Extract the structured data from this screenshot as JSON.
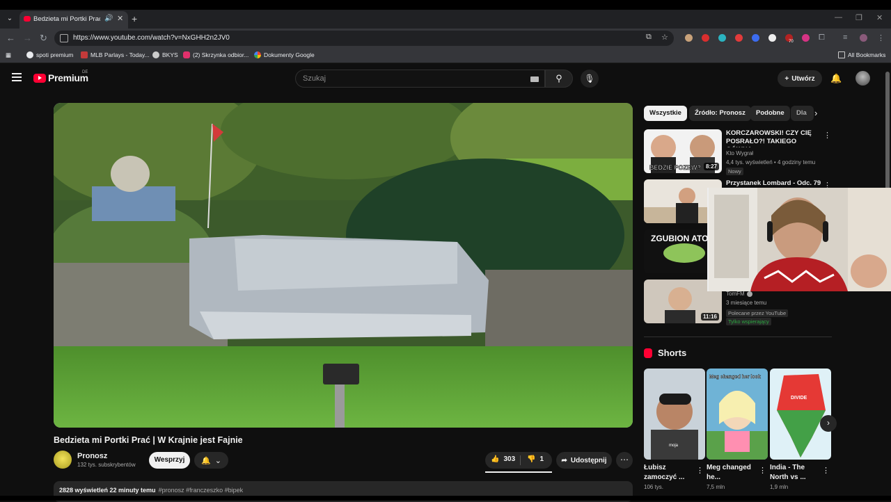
{
  "browser": {
    "tab_title": "Bedzieta mi Portki Prać | W",
    "url": "https://www.youtube.com/watch?v=NxGHH2n2JV0",
    "bookmarks": [
      {
        "label": "spoti premium",
        "color": "#e8eaed"
      },
      {
        "label": "MLB Parlays - Today...",
        "color": "#c23a3a"
      },
      {
        "label": "BKYS",
        "color": "#cccccc"
      },
      {
        "label": "(2) Skrzynka odbior...",
        "color": "#e1306c"
      },
      {
        "label": "Dokumenty Google",
        "color": "#4285f4"
      }
    ],
    "all_bookmarks": "All Bookmarks",
    "extension_badge": "70"
  },
  "header": {
    "logo_text": "Premium",
    "country_code": "DE",
    "search_placeholder": "Szukaj",
    "create_label": "Utwórz"
  },
  "video": {
    "title": "Bedzieta mi Portki Prać | W Krajnie jest Fajnie",
    "channel": "Pronosz",
    "subscribers": "132 tys. subskrybentów",
    "support_label": "Wesprzyj",
    "likes": "303",
    "dislikes": "1",
    "share_label": "Udostępnij",
    "description_meta": "2828 wyświetleń  22 minuty temu",
    "description_tags": "#pronosz #franczeszko #bipek"
  },
  "chips": [
    "Wszystkie",
    "Źródło: Pronosz",
    "Podobne",
    "Dla"
  ],
  "recommendations": [
    {
      "title": "KORCZAROWSKI! CZY CIĘ POSRAŁO?! TAKIEGO GÓWNA ...",
      "channel": "Kto Wygrał",
      "meta": "4,4 tys. wyświetleń • 4 godziny temu",
      "badge": "Nowy",
      "duration": "8:27",
      "thumb_text": "BĘDZIE POZEW?"
    },
    {
      "title": "Przystanek Lombard - Odc. 79",
      "channel": "",
      "meta": "",
      "badge": "",
      "duration": "",
      "thumb_text": ""
    },
    {
      "title": "",
      "channel": "",
      "meta": "",
      "badge": "",
      "duration": "",
      "thumb_text": "ZGUBION ATOMOWK"
    },
    {
      "title": "",
      "channel": "TomFM",
      "meta": "3 miesiące temu",
      "badge": "Polecane przez YouTube",
      "badge2": "Tylko wspierający",
      "duration": "11:16",
      "thumb_text": ""
    }
  ],
  "shorts": {
    "heading": "Shorts",
    "items": [
      {
        "title": "Łubisz zamoczyć ...",
        "views": "106 tys.",
        "caption": "moja"
      },
      {
        "title": "Meg changed he...",
        "views": "7,5 mln",
        "caption": "Meg changed her look"
      },
      {
        "title": "India - The North vs ...",
        "views": "1,9 mln",
        "caption": "DIVIDE"
      }
    ]
  },
  "colors": {
    "accent": "#ff0033",
    "background": "#0f0f0f",
    "surface": "#272727",
    "green": "#2ba640"
  }
}
